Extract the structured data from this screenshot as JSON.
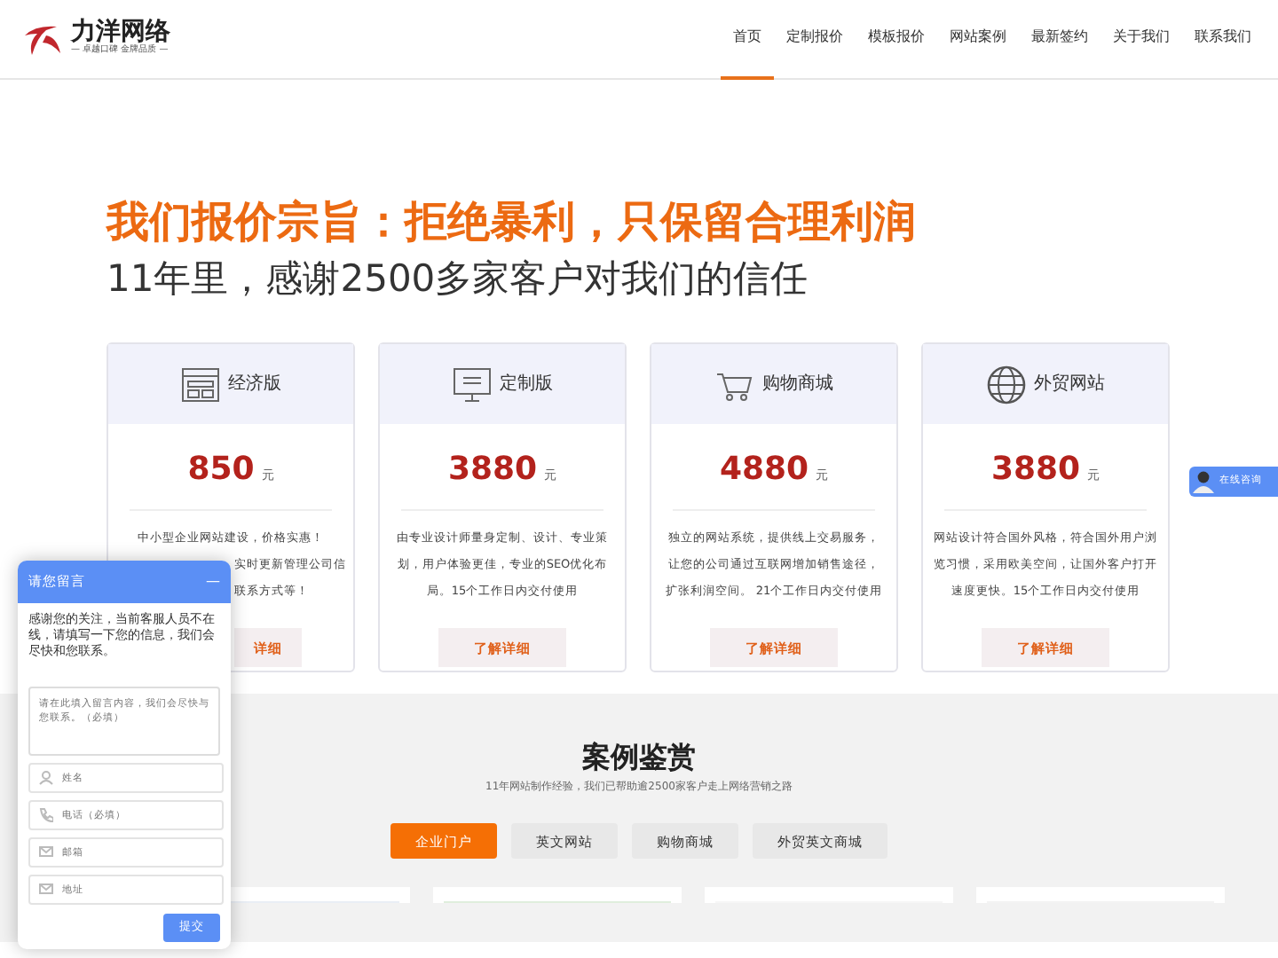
{
  "header": {
    "logo": {
      "name": "力洋网络",
      "tagline": "— 卓越口碑 金牌品质 —"
    },
    "nav": [
      {
        "label": "首页",
        "selected": true
      },
      {
        "label": "定制报价",
        "selected": false
      },
      {
        "label": "模板报价",
        "selected": false
      },
      {
        "label": "网站案例",
        "selected": false
      },
      {
        "label": "最新签约",
        "selected": false
      },
      {
        "label": "关于我们",
        "selected": false
      },
      {
        "label": "联系我们",
        "selected": false
      }
    ]
  },
  "hero": {
    "title": "我们报价宗旨：拒绝暴利，只保留合理利润",
    "subtitle": "11年里，感谢2500多家客户对我们的信任"
  },
  "plans": [
    {
      "kind": "layout",
      "name": "经济版",
      "price": "850",
      "unit": "元",
      "covered": true,
      "lines": [
        "中小型企业网站建设，价格实惠！",
        "实时更新管理公司信",
        "联系方式等！"
      ],
      "button": "详细"
    },
    {
      "kind": "monitor",
      "name": "定制版",
      "price": "3880",
      "unit": "元",
      "covered": false,
      "lines": [
        "由专业设计师量身定制、设计、专业策",
        "划，用户体验更佳，专业的SEO优化布",
        "局。15个工作日内交付使用"
      ],
      "button": "了解详细"
    },
    {
      "kind": "cart",
      "name": "购物商城",
      "price": "4880",
      "unit": "元",
      "covered": false,
      "lines": [
        "独立的网站系统，提供线上交易服务，",
        "让您的公司通过互联网增加销售途径，",
        "扩张利润空间。 21个工作日内交付使用"
      ],
      "button": "了解详细"
    },
    {
      "kind": "globe",
      "name": "外贸网站",
      "price": "3880",
      "unit": "元",
      "covered": false,
      "lines": [
        "网站设计符合国外风格，符合国外用户浏",
        "览习惯，采用欧美空间，让国外客户打开",
        "速度更快。15个工作日内交付使用"
      ],
      "button": "了解详细"
    }
  ],
  "cases": {
    "title": "案例鉴赏",
    "subtitle": "11年网站制作经验，我们已帮助逾2500家客户走上网络营销之路",
    "tabs": [
      {
        "label": "企业门户",
        "selected": true
      },
      {
        "label": "英文网站",
        "selected": false
      },
      {
        "label": "购物商城",
        "selected": false
      },
      {
        "label": "外贸英文商城",
        "selected": false
      }
    ]
  },
  "chat": {
    "title": "请您留言",
    "minimize": "—",
    "message": "感谢您的关注，当前客服人员不在线，请填写一下您的信息，我们会尽快和您联系。",
    "textarea_placeholder": "请在此填入留言内容，我们会尽快与您联系。（必填）",
    "fields": [
      {
        "kind": "person",
        "placeholder": "姓名"
      },
      {
        "kind": "phone",
        "placeholder": "电话（必填）"
      },
      {
        "kind": "mail",
        "placeholder": "邮箱"
      },
      {
        "kind": "mail",
        "placeholder": "地址"
      }
    ],
    "submit": "提交"
  },
  "consult_button": "在线咨询"
}
